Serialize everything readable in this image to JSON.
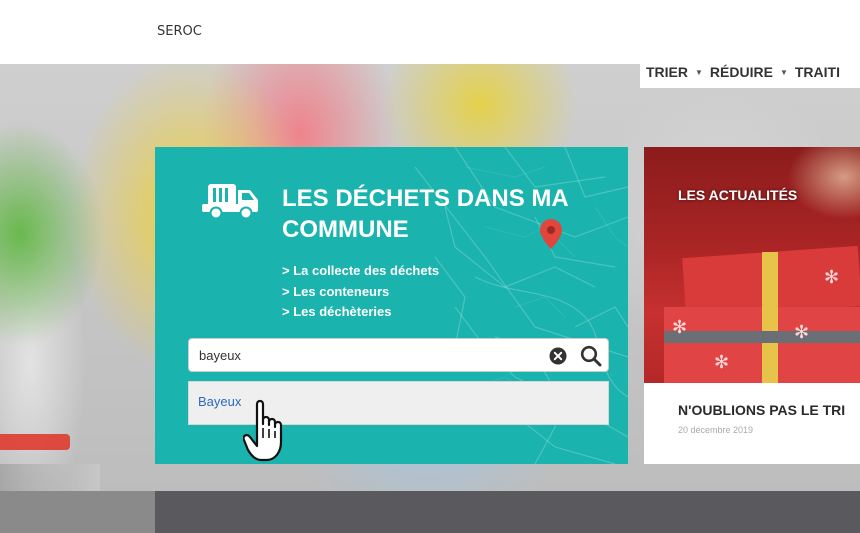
{
  "header": {
    "brand": "SEROC"
  },
  "nav": {
    "items": [
      "TRIER",
      "RÉDUIRE",
      "TRAITI"
    ]
  },
  "card": {
    "title": "LES DÉCHETS DANS MA COMMUNE",
    "links": [
      "> La collecte des déchets",
      "> Les conteneurs",
      "> Les déchèteries"
    ],
    "icons": {
      "truck": "truck-icon",
      "pin": "map-pin-icon"
    },
    "accent_color": "#1ab3ae"
  },
  "search": {
    "value": "bayeux",
    "suggestions": [
      "Bayeux"
    ],
    "icons": {
      "clear": "clear-icon",
      "submit": "search-icon"
    }
  },
  "news": {
    "label": "LES ACTUALITÉS",
    "title": "N'OUBLIONS PAS LE TRI",
    "date": "20 décembre 2019"
  }
}
